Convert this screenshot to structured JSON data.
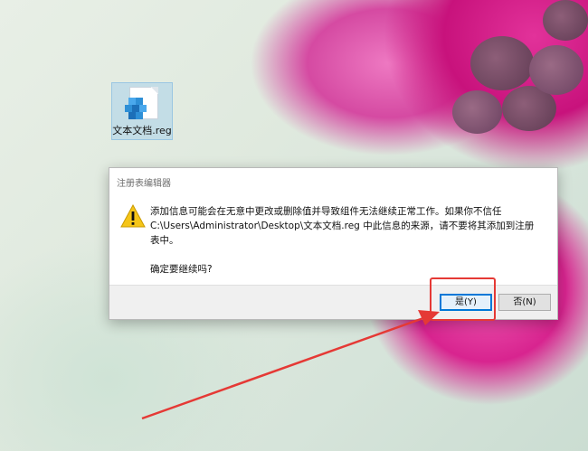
{
  "desktop": {
    "icon_label": "文本文档.reg",
    "icon_name": "registry-file-icon"
  },
  "dialog": {
    "title": "注册表编辑器",
    "message_line1": "添加信息可能会在无意中更改或删除值并导致组件无法继续正常工作。如果你不信任",
    "message_line2": "C:\\Users\\Administrator\\Desktop\\文本文档.reg 中此信息的来源，请不要将其添加到注册",
    "message_line3": "表中。",
    "confirm": "确定要继续吗?",
    "yes_label": "是(Y)",
    "no_label": "否(N)"
  },
  "colors": {
    "accent": "#0078d7",
    "annotation_red": "#e53935",
    "warning_yellow": "#f5c518"
  }
}
